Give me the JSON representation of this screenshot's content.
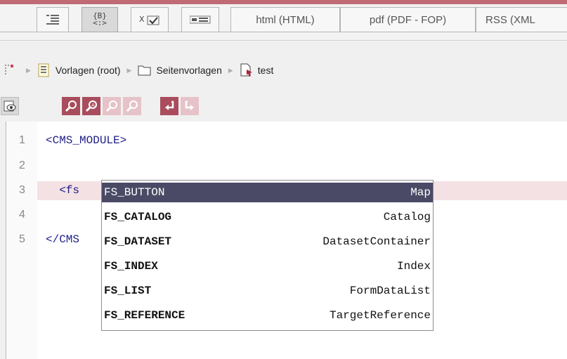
{
  "tabs": {
    "icon_tabs": [
      "outline-icon",
      "code-braces-icon",
      "checkbox-form-icon",
      "preview-form-icon"
    ],
    "labeled": [
      "html (HTML)",
      "pdf (PDF - FOP)",
      "RSS (XML"
    ]
  },
  "breadcrumb": {
    "items": [
      {
        "label": "Vorlagen (root)",
        "icon": "template-folder-icon"
      },
      {
        "label": "Seitenvorlagen",
        "icon": "folder-icon"
      },
      {
        "label": "test",
        "icon": "page-template-icon"
      }
    ]
  },
  "toolbar": {
    "buttons": [
      "view-icon",
      "search-icon",
      "search-replace-icon",
      "find-next-icon",
      "find-prev-icon",
      "undo-icon",
      "redo-icon"
    ]
  },
  "editor": {
    "line_numbers": [
      "1",
      "2",
      "3",
      "4",
      "5"
    ],
    "lines": [
      "<CMS_MODULE>",
      "",
      "  <fs",
      "",
      "</CMS"
    ]
  },
  "autocomplete": {
    "options": [
      {
        "name": "FS_BUTTON",
        "type": "Map",
        "selected": true
      },
      {
        "name": "FS_CATALOG",
        "type": "Catalog"
      },
      {
        "name": "FS_DATASET",
        "type": "DatasetContainer"
      },
      {
        "name": "FS_INDEX",
        "type": "Index"
      },
      {
        "name": "FS_LIST",
        "type": "FormDataList"
      },
      {
        "name": "FS_REFERENCE",
        "type": "TargetReference"
      }
    ]
  },
  "colors": {
    "accent": "#a94c5d",
    "selection": "#4a4a66",
    "current_line": "#f4e1e3"
  }
}
